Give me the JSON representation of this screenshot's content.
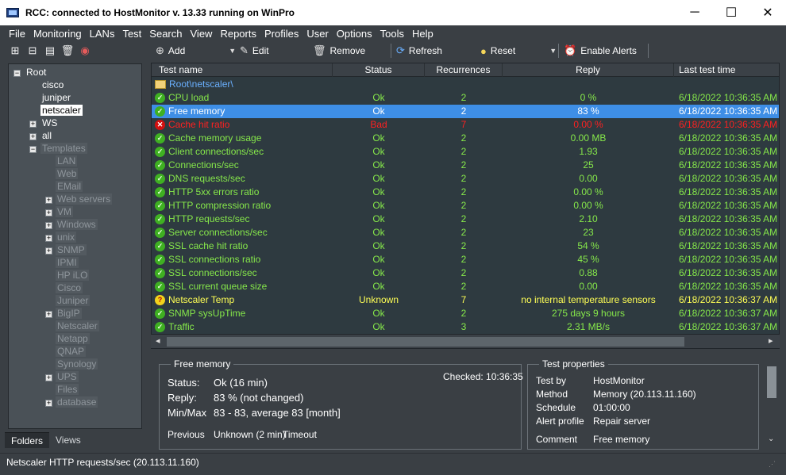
{
  "window": {
    "title": "RCC: connected to HostMonitor v. 13.33 running on WinPro",
    "minimize": "─",
    "maximize": "☐",
    "close": "✕"
  },
  "menu": [
    "File",
    "Monitoring",
    "LANs",
    "Test",
    "Search",
    "View",
    "Reports",
    "Profiles",
    "User",
    "Options",
    "Tools",
    "Help"
  ],
  "tree": {
    "root": "Root",
    "items": [
      {
        "label": "cisco"
      },
      {
        "label": "juniper"
      },
      {
        "label": "netscaler"
      },
      {
        "label": "WS"
      },
      {
        "label": "all"
      },
      {
        "label": "Templates"
      },
      {
        "label": "LAN"
      },
      {
        "label": "Web"
      },
      {
        "label": "EMail"
      },
      {
        "label": "Web servers"
      },
      {
        "label": "VM"
      },
      {
        "label": "Windows"
      },
      {
        "label": "unix"
      },
      {
        "label": "SNMP"
      },
      {
        "label": "IPMI"
      },
      {
        "label": "HP iLO"
      },
      {
        "label": "Cisco"
      },
      {
        "label": "Juniper"
      },
      {
        "label": "BigIP"
      },
      {
        "label": "Netscaler"
      },
      {
        "label": "Netapp"
      },
      {
        "label": "QNAP"
      },
      {
        "label": "Synology"
      },
      {
        "label": "UPS"
      },
      {
        "label": "Files"
      },
      {
        "label": "database"
      }
    ]
  },
  "left_tabs": {
    "folders": "Folders",
    "views": "Views"
  },
  "toolbar": {
    "add": "Add",
    "edit": "Edit",
    "remove": "Remove",
    "refresh": "Refresh",
    "reset": "Reset",
    "enable_alerts": "Enable Alerts"
  },
  "grid": {
    "headers": {
      "name": "Test name",
      "status": "Status",
      "recurrences": "Recurrences",
      "reply": "Reply",
      "last": "Last test time"
    },
    "folder": "Root\\netscaler\\",
    "rows": [
      {
        "name": "CPU load",
        "status": "Ok",
        "rec": "2",
        "reply": "0 %",
        "last": "6/18/2022 10:36:35 AM",
        "kind": "ok"
      },
      {
        "name": "Free memory",
        "status": "Ok",
        "rec": "2",
        "reply": "83 %",
        "last": "6/18/2022 10:36:35 AM",
        "kind": "selected"
      },
      {
        "name": "Cache hit ratio",
        "status": "Bad",
        "rec": "7",
        "reply": "0.00 %",
        "last": "6/18/2022 10:36:35 AM",
        "kind": "bad"
      },
      {
        "name": "Cache memory usage",
        "status": "Ok",
        "rec": "2",
        "reply": "0.00 MB",
        "last": "6/18/2022 10:36:35 AM",
        "kind": "ok"
      },
      {
        "name": "Client connections/sec",
        "status": "Ok",
        "rec": "2",
        "reply": "1.93",
        "last": "6/18/2022 10:36:35 AM",
        "kind": "ok"
      },
      {
        "name": "Connections/sec",
        "status": "Ok",
        "rec": "2",
        "reply": "25",
        "last": "6/18/2022 10:36:35 AM",
        "kind": "ok"
      },
      {
        "name": "DNS requests/sec",
        "status": "Ok",
        "rec": "2",
        "reply": "0.00",
        "last": "6/18/2022 10:36:35 AM",
        "kind": "ok"
      },
      {
        "name": "HTTP 5xx errors ratio",
        "status": "Ok",
        "rec": "2",
        "reply": "0.00 %",
        "last": "6/18/2022 10:36:35 AM",
        "kind": "ok"
      },
      {
        "name": "HTTP compression ratio",
        "status": "Ok",
        "rec": "2",
        "reply": "0.00 %",
        "last": "6/18/2022 10:36:35 AM",
        "kind": "ok"
      },
      {
        "name": "HTTP requests/sec",
        "status": "Ok",
        "rec": "2",
        "reply": "2.10",
        "last": "6/18/2022 10:36:35 AM",
        "kind": "ok"
      },
      {
        "name": "Server connections/sec",
        "status": "Ok",
        "rec": "2",
        "reply": "23",
        "last": "6/18/2022 10:36:35 AM",
        "kind": "ok"
      },
      {
        "name": "SSL cache hit ratio",
        "status": "Ok",
        "rec": "2",
        "reply": "54 %",
        "last": "6/18/2022 10:36:35 AM",
        "kind": "ok"
      },
      {
        "name": "SSL connections ratio",
        "status": "Ok",
        "rec": "2",
        "reply": "45 %",
        "last": "6/18/2022 10:36:35 AM",
        "kind": "ok"
      },
      {
        "name": "SSL connections/sec",
        "status": "Ok",
        "rec": "2",
        "reply": "0.88",
        "last": "6/18/2022 10:36:35 AM",
        "kind": "ok"
      },
      {
        "name": "SSL current queue size",
        "status": "Ok",
        "rec": "2",
        "reply": "0.00",
        "last": "6/18/2022 10:36:35 AM",
        "kind": "ok"
      },
      {
        "name": "Netscaler Temp",
        "status": "Unknown",
        "rec": "7",
        "reply": "no internal temperature sensors",
        "last": "6/18/2022 10:36:37 AM",
        "kind": "unknown"
      },
      {
        "name": "SNMP sysUpTime",
        "status": "Ok",
        "rec": "2",
        "reply": "275 days 9 hours",
        "last": "6/18/2022 10:36:37 AM",
        "kind": "ok"
      },
      {
        "name": "Traffic",
        "status": "Ok",
        "rec": "3",
        "reply": "2.31 MB/s",
        "last": "6/18/2022 10:36:37 AM",
        "kind": "ok"
      }
    ]
  },
  "details": {
    "legend": "Free memory",
    "checked": "Checked: 10:36:35",
    "status_label": "Status:",
    "status_value": "Ok (16 min)",
    "reply_label": "Reply:",
    "reply_value": "83 %  (not changed)",
    "minmax_label": "Min/Max",
    "minmax_value": "83 - 83, average 83  [month]",
    "previous_label": "Previous",
    "previous_value": "Unknown (2 min)",
    "previous_extra": "Timeout"
  },
  "properties": {
    "legend": "Test properties",
    "items": [
      {
        "k": "Test by",
        "v": "HostMonitor"
      },
      {
        "k": "Method",
        "v": "Memory (20.113.11.160)"
      },
      {
        "k": "Schedule",
        "v": "01:00:00"
      },
      {
        "k": "Alert profile",
        "v": "Repair server"
      },
      {
        "k": "Comment",
        "v": "Free memory"
      }
    ]
  },
  "statusbar": "Netscaler HTTP requests/sec (20.113.11.160)",
  "colors": {
    "ok": "#86e84a",
    "bad": "#ff2020",
    "unknown": "#ffff55",
    "selected_row": "#3e8ee6"
  }
}
